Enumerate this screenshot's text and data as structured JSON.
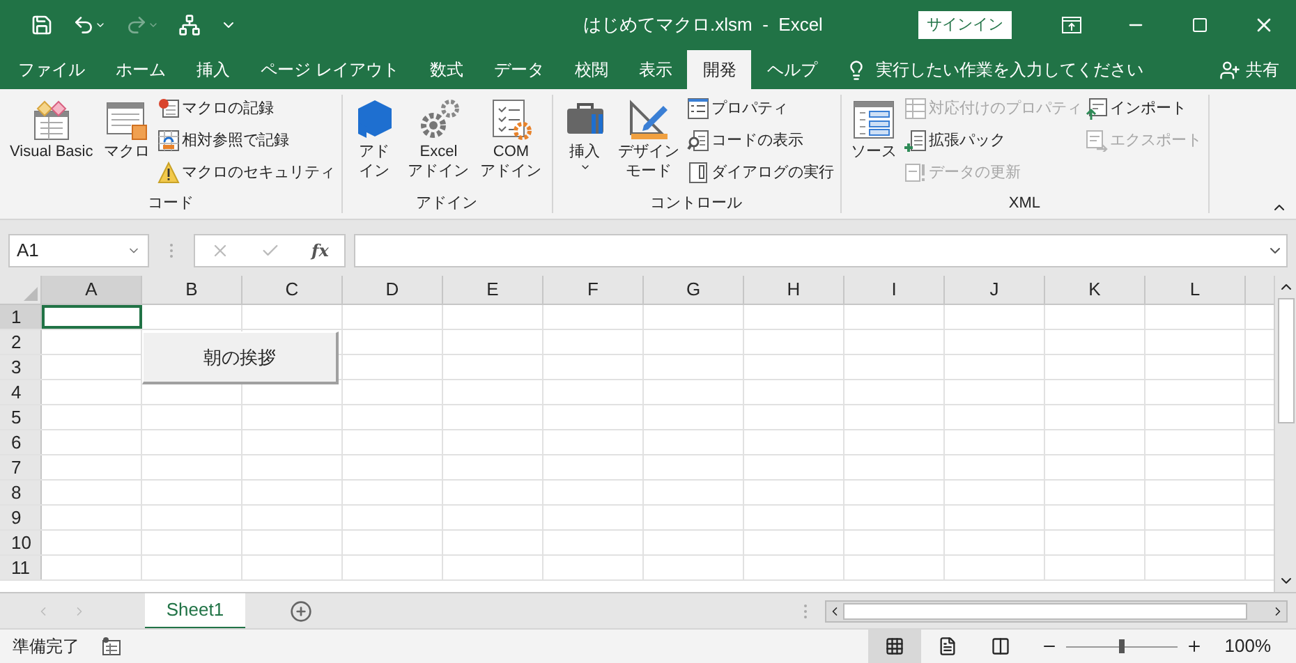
{
  "window": {
    "title": "はじめてマクロ.xlsm  -  Excel",
    "sign_in": "サインイン"
  },
  "menu_tabs": [
    {
      "label": "ファイル",
      "selected": false
    },
    {
      "label": "ホーム",
      "selected": false
    },
    {
      "label": "挿入",
      "selected": false
    },
    {
      "label": "ページ レイアウト",
      "selected": false
    },
    {
      "label": "数式",
      "selected": false
    },
    {
      "label": "データ",
      "selected": false
    },
    {
      "label": "校閲",
      "selected": false
    },
    {
      "label": "表示",
      "selected": false
    },
    {
      "label": "開発",
      "selected": true
    },
    {
      "label": "ヘルプ",
      "selected": false
    }
  ],
  "tell_me": "実行したい作業を入力してください",
  "share": "共有",
  "ribbon_groups": [
    {
      "label": "コード",
      "columns": [
        {
          "kind": "large",
          "lines": [
            "Visual Basic"
          ]
        },
        {
          "kind": "large",
          "lines": [
            "マクロ"
          ]
        },
        {
          "kind": "stack",
          "items": [
            {
              "label": "マクロの記録",
              "disabled": false
            },
            {
              "label": "相対参照で記録",
              "disabled": false
            },
            {
              "label": "マクロのセキュリティ",
              "disabled": false
            }
          ]
        }
      ]
    },
    {
      "label": "アドイン",
      "columns": [
        {
          "kind": "large",
          "lines": [
            "アド",
            "イン"
          ]
        },
        {
          "kind": "large",
          "lines": [
            "Excel",
            "アドイン"
          ]
        },
        {
          "kind": "large",
          "lines": [
            "COM",
            "アドイン"
          ]
        }
      ]
    },
    {
      "label": "コントロール",
      "columns": [
        {
          "kind": "large",
          "lines": [
            "挿入"
          ],
          "dropdown": true
        },
        {
          "kind": "large",
          "lines": [
            "デザイン",
            "モード"
          ]
        },
        {
          "kind": "stack",
          "items": [
            {
              "label": "プロパティ",
              "disabled": false
            },
            {
              "label": "コードの表示",
              "disabled": false
            },
            {
              "label": "ダイアログの実行",
              "disabled": false
            }
          ]
        }
      ]
    },
    {
      "label": "XML",
      "columns": [
        {
          "kind": "large",
          "lines": [
            "ソース"
          ]
        },
        {
          "kind": "stack",
          "items": [
            {
              "label": "対応付けのプロパティ",
              "disabled": true
            },
            {
              "label": "拡張パック",
              "disabled": false
            },
            {
              "label": "データの更新",
              "disabled": true
            }
          ]
        },
        {
          "kind": "stack",
          "items": [
            {
              "label": "インポート",
              "disabled": false
            },
            {
              "label": "エクスポート",
              "disabled": true
            }
          ]
        }
      ]
    }
  ],
  "name_box": "A1",
  "function_button": "fx",
  "columns": [
    {
      "label": "A",
      "selected": true
    },
    {
      "label": "B",
      "selected": false
    },
    {
      "label": "C",
      "selected": false
    },
    {
      "label": "D",
      "selected": false
    },
    {
      "label": "E",
      "selected": false
    },
    {
      "label": "F",
      "selected": false
    },
    {
      "label": "G",
      "selected": false
    },
    {
      "label": "H",
      "selected": false
    },
    {
      "label": "I",
      "selected": false
    },
    {
      "label": "J",
      "selected": false
    },
    {
      "label": "K",
      "selected": false
    },
    {
      "label": "L",
      "selected": false
    }
  ],
  "rows": [
    {
      "label": "1",
      "selected": true
    },
    {
      "label": "2",
      "selected": false
    },
    {
      "label": "3",
      "selected": false
    },
    {
      "label": "4",
      "selected": false
    },
    {
      "label": "5",
      "selected": false
    },
    {
      "label": "6",
      "selected": false
    },
    {
      "label": "7",
      "selected": false
    },
    {
      "label": "8",
      "selected": false
    },
    {
      "label": "9",
      "selected": false
    },
    {
      "label": "10",
      "selected": false
    },
    {
      "label": "11",
      "selected": false
    }
  ],
  "sheet_button": "朝の挨拶",
  "sheet_tabs": [
    {
      "label": "Sheet1",
      "selected": true
    }
  ],
  "status_bar": {
    "text": "準備完了",
    "views": [
      {
        "selected": true
      },
      {
        "selected": false
      },
      {
        "selected": false
      }
    ],
    "zoom": {
      "level": 0.5,
      "reading": "100%"
    }
  }
}
